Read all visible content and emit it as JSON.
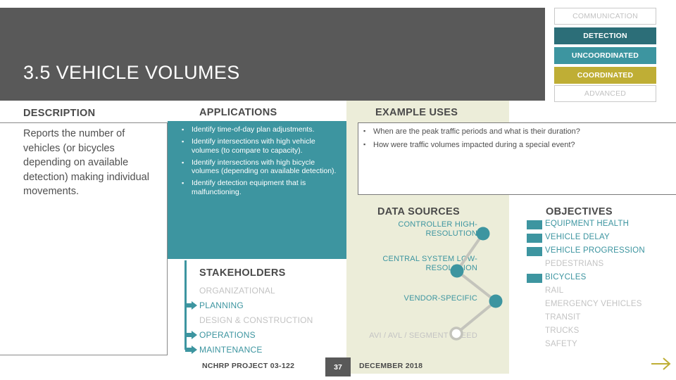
{
  "header": {
    "title": "3.5 VEHICLE VOLUMES"
  },
  "maturity_labels": [
    {
      "label": "COMMUNICATION",
      "state": "off",
      "color": "#ffffff"
    },
    {
      "label": "DETECTION",
      "state": "on",
      "color": "#2c6e78"
    },
    {
      "label": "UNCOORDINATED",
      "state": "on",
      "color": "#3d95a0"
    },
    {
      "label": "COORDINATED",
      "state": "on",
      "color": "#bfae35"
    },
    {
      "label": "ADVANCED",
      "state": "off",
      "color": "#ffffff"
    }
  ],
  "description": {
    "heading": "DESCRIPTION",
    "text": "Reports the number of vehicles (or bicycles depending on available detection) making individual movements."
  },
  "applications": {
    "heading": "APPLICATIONS",
    "items": [
      "Identify time-of-day plan adjustments.",
      "Identify intersections with high vehicle volumes (to compare to capacity).",
      "Identify intersections with high bicycle volumes (depending on available detection).",
      "Identify detection equipment that is malfunctioning."
    ]
  },
  "example_uses": {
    "heading": "EXAMPLE USES",
    "items": [
      "When are the peak traffic periods and what is their duration?",
      "How were traffic volumes impacted during a special event?"
    ]
  },
  "stakeholders": {
    "heading": "STAKEHOLDERS",
    "items": [
      {
        "label": "ORGANIZATIONAL",
        "state": "off"
      },
      {
        "label": "PLANNING",
        "state": "on"
      },
      {
        "label": "DESIGN & CONSTRUCTION",
        "state": "off"
      },
      {
        "label": "OPERATIONS",
        "state": "on"
      },
      {
        "label": "MAINTENANCE",
        "state": "on"
      }
    ]
  },
  "data_sources": {
    "heading": "DATA SOURCES",
    "items": [
      {
        "label": "CONTROLLER HIGH-RESOLUTION",
        "state": "on"
      },
      {
        "label": "CENTRAL SYSTEM LOW-RESOLUTION",
        "state": "on"
      },
      {
        "label": "VENDOR-SPECIFIC",
        "state": "on"
      },
      {
        "label": "AVI / AVL / SEGMENT SPEED",
        "state": "off"
      }
    ]
  },
  "objectives": {
    "heading": "OBJECTIVES",
    "items": [
      {
        "label": "EQUIPMENT HEALTH",
        "state": "on"
      },
      {
        "label": "VEHICLE DELAY",
        "state": "on"
      },
      {
        "label": "VEHICLE PROGRESSION",
        "state": "on"
      },
      {
        "label": "PEDESTRIANS",
        "state": "off"
      },
      {
        "label": "BICYCLES",
        "state": "on"
      },
      {
        "label": "RAIL",
        "state": "off"
      },
      {
        "label": "EMERGENCY VEHICLES",
        "state": "off"
      },
      {
        "label": "TRANSIT",
        "state": "off"
      },
      {
        "label": "TRUCKS",
        "state": "off"
      },
      {
        "label": "SAFETY",
        "state": "off"
      }
    ]
  },
  "footer": {
    "project": "NCHRP PROJECT 03-122",
    "page": "37",
    "date": "DECEMBER 2018"
  },
  "colors": {
    "accent_teal": "#3d95a0",
    "dark_teal": "#2c6e78",
    "gold": "#bfae35",
    "header_gray": "#595959",
    "cream": "#ecedd9",
    "inactive_gray": "#c3c3c3"
  }
}
